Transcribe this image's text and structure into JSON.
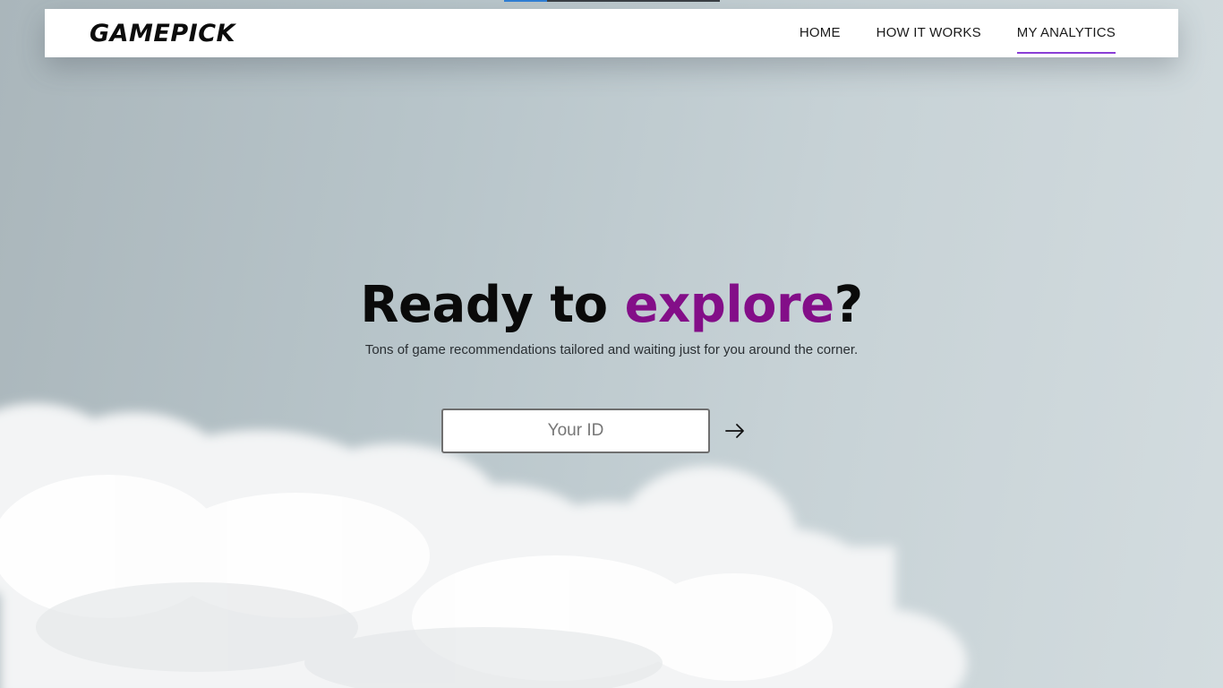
{
  "brand": {
    "name": "GAMEPICK"
  },
  "nav": {
    "items": [
      {
        "label": "HOME",
        "active": false
      },
      {
        "label": "HOW IT WORKS",
        "active": false
      },
      {
        "label": "MY ANALYTICS",
        "active": true
      }
    ]
  },
  "hero": {
    "title_before": "Ready to ",
    "title_accent": "explore",
    "title_after": "?",
    "subtitle": "Tons of game recommendations tailored and waiting just for you around the corner."
  },
  "form": {
    "id_placeholder": "Your ID",
    "id_value": "",
    "submit_icon": "arrow-right-icon"
  },
  "colors": {
    "accent": "#830e88",
    "nav_underline": "#8a3fd6",
    "sky": "#b8c5ca"
  }
}
